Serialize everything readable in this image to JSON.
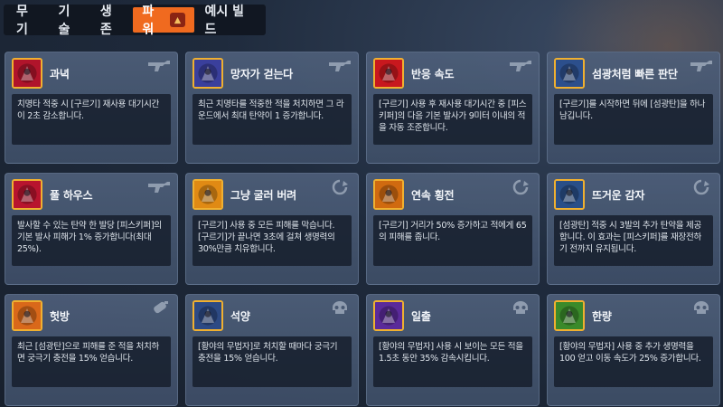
{
  "tabs": [
    {
      "label": "무기",
      "active": false
    },
    {
      "label": "기술",
      "active": false
    },
    {
      "label": "생존",
      "active": false
    },
    {
      "label": "파워",
      "active": true,
      "badge_icon": "power-badge-icon"
    },
    {
      "label": "예시 빌드",
      "active": false
    }
  ],
  "colors": {
    "accent": "#f06a1f",
    "icon_border": "#f0b030"
  },
  "cards": [
    {
      "title": "과녁",
      "type_icon": "revolver-icon",
      "icon": "crosshair-power-icon",
      "icon_bg": "#b0142b",
      "desc": "치명타 적중 시 [구르기] 재사용 대기시간이 2초 감소합니다."
    },
    {
      "title": "망자가 걷는다",
      "type_icon": "revolver-icon",
      "icon": "walking-dead-power-icon",
      "icon_bg": "#3a3f9c",
      "desc": "최근 치명타를 적중한 적을 처치하면 그 라운드에서 최대 탄약이 1 증가합니다."
    },
    {
      "title": "반응 속도",
      "type_icon": "revolver-icon",
      "icon": "reflex-target-power-icon",
      "icon_bg": "#c8181e",
      "desc": "[구르기] 사용 후 재사용 대기시간 중 [피스키퍼]의 다음 기본 발사가 9미터 이내의 적을 자동 조준합니다."
    },
    {
      "title": "섬광처럼 빠른 판단",
      "type_icon": "revolver-icon",
      "icon": "flash-decision-power-icon",
      "icon_bg": "#2c4f8c",
      "desc": "[구르기]를 시작하면 뒤에 [섬광탄]을 하나 남깁니다."
    },
    {
      "title": "풀 하우스",
      "type_icon": "revolver-icon",
      "icon": "full-house-power-icon",
      "icon_bg": "#b8142e",
      "desc": "발사할 수 있는 탄약 한 발당 [피스키퍼]의 기본 발사 피해가 1% 증가합니다(최대 25%)."
    },
    {
      "title": "그냥 굴러 버려",
      "type_icon": "roll-icon",
      "icon": "just-roll-power-icon",
      "icon_bg": "#e08a14",
      "desc": "[구르기] 사용 중 모든 피해를 막습니다. [구르기]가 끝나면 3초에 걸쳐 생명력의 30%만큼 치유합니다."
    },
    {
      "title": "연속 횡전",
      "type_icon": "roll-icon",
      "icon": "barrel-roll-power-icon",
      "icon_bg": "#d06a10",
      "desc": "[구르기] 거리가 50% 증가하고 적에게 65의 피해를 줍니다."
    },
    {
      "title": "뜨거운 감자",
      "type_icon": "roll-icon",
      "icon": "hot-potato-power-icon",
      "icon_bg": "#2a4f88",
      "desc": "[섬광탄] 적중 시 3발의 추가 탄약을 제공합니다. 이 효과는 [피스키퍼]를 재장전하기 전까지 유지됩니다."
    },
    {
      "title": "헛방",
      "type_icon": "grenade-icon",
      "icon": "misfire-power-icon",
      "icon_bg": "#d9681a",
      "desc": "최근 [섬광탄]으로 피해를 준 적을 처치하면 궁극기 충전을 15% 얻습니다."
    },
    {
      "title": "석양",
      "type_icon": "skull-icon",
      "icon": "sunset-power-icon",
      "icon_bg": "#2d4a84",
      "desc": "[황야의 무법자]로 처치할 때마다 궁극기 충전을 15% 얻습니다."
    },
    {
      "title": "일출",
      "type_icon": "skull-icon",
      "icon": "sunrise-power-icon",
      "icon_bg": "#5b2a9a",
      "desc": "[황야의 무법자] 사용 시 보이는 모든 적을 1.5초 동안 35% 감속시킵니다."
    },
    {
      "title": "한량",
      "type_icon": "skull-icon",
      "icon": "drifter-power-icon",
      "icon_bg": "#3a8a2a",
      "desc": "[황야의 무법자] 사용 중 추가 생명력을 100 얻고 이동 속도가 25% 증가합니다."
    }
  ]
}
